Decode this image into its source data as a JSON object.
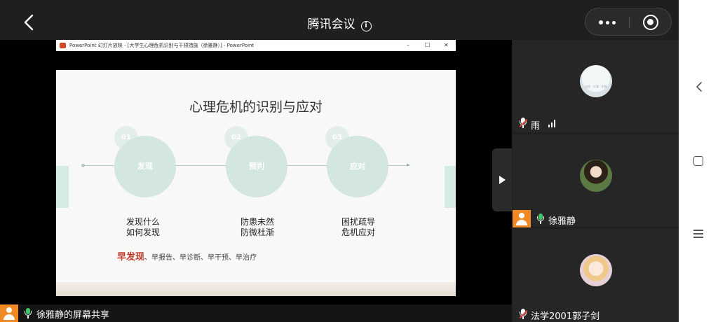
{
  "header": {
    "title": "腾讯会议",
    "info_glyph": "i"
  },
  "ppt_window": {
    "title": "PowerPoint 幻灯片放映 - [大学生心理危机识别与干预措施（徐雅静）] - PowerPoint",
    "minimize": "–",
    "maximize": "☐",
    "close": "✕"
  },
  "slide": {
    "title": "心理危机的识别与应对",
    "steps": [
      {
        "num": "01",
        "label": "发现",
        "desc_line1": "发现什么",
        "desc_line2": "如何发现"
      },
      {
        "num": "02",
        "label": "预判",
        "desc_line1": "防患未然",
        "desc_line2": "防微杜渐"
      },
      {
        "num": "03",
        "label": "应对",
        "desc_line1": "困扰疏导",
        "desc_line2": "危机应对"
      }
    ],
    "footer_highlight": "早发现",
    "footer_rest": "、早报告、早诊断、早干预、早治疗"
  },
  "sharer": {
    "name": "徐雅静的屏幕共享"
  },
  "participants": [
    {
      "name": "雨",
      "mic": "muted"
    },
    {
      "name": "徐雅静",
      "mic": "on"
    },
    {
      "name": "法学2001郭子剑",
      "mic": "muted"
    }
  ],
  "colors": {
    "accent_orange": "#f08a24",
    "mic_on": "#3ec66b",
    "mic_muted": "#e5473c",
    "slide_red": "#c0392b"
  }
}
